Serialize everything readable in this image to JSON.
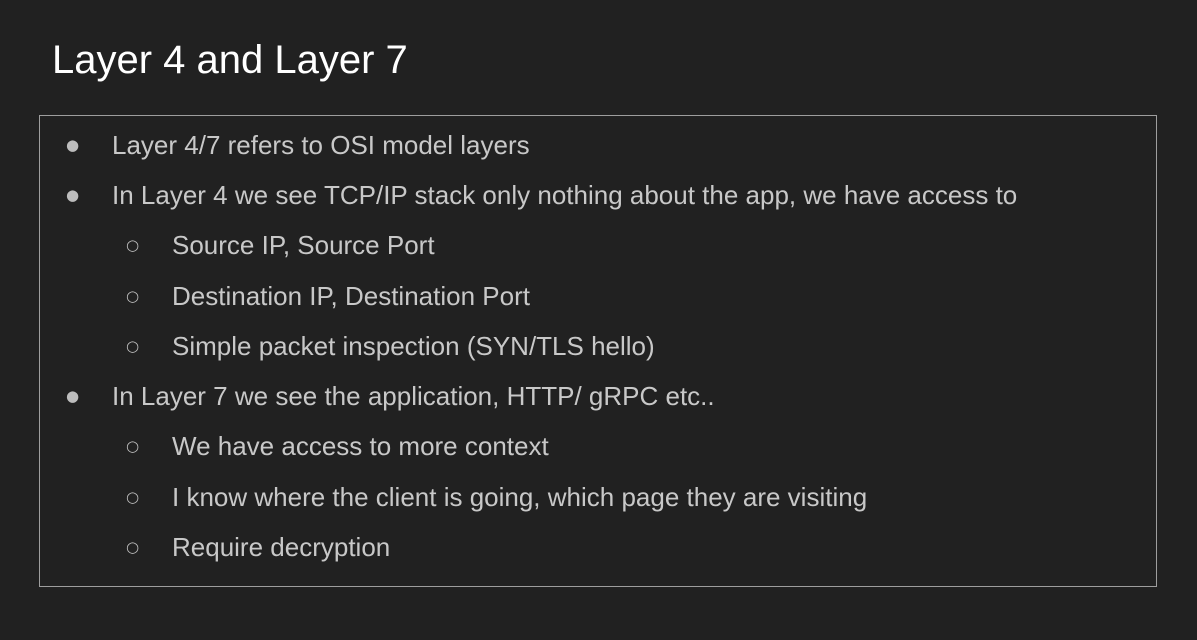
{
  "slide": {
    "title": "Layer 4 and Layer 7",
    "bullets": [
      {
        "marker": "●",
        "text": "Layer 4/7 refers to OSI model layers"
      },
      {
        "marker": "●",
        "text": "In Layer 4 we see TCP/IP stack only nothing about the app, we have access to"
      },
      {
        "marker": "○",
        "text": "Source IP, Source Port"
      },
      {
        "marker": "○",
        "text": "Destination IP, Destination Port"
      },
      {
        "marker": "○",
        "text": "Simple packet inspection (SYN/TLS hello)"
      },
      {
        "marker": "●",
        "text": "In Layer 7 we see the application, HTTP/ gRPC etc.."
      },
      {
        "marker": "○",
        "text": "We have access to more context"
      },
      {
        "marker": "○",
        "text": "I know where the client is going, which page they are visiting"
      },
      {
        "marker": "○",
        "text": "Require decryption"
      }
    ]
  },
  "colors": {
    "background": "#212121",
    "title": "#ffffff",
    "body_text": "#c8c8c8",
    "border": "#9e9e9e"
  }
}
